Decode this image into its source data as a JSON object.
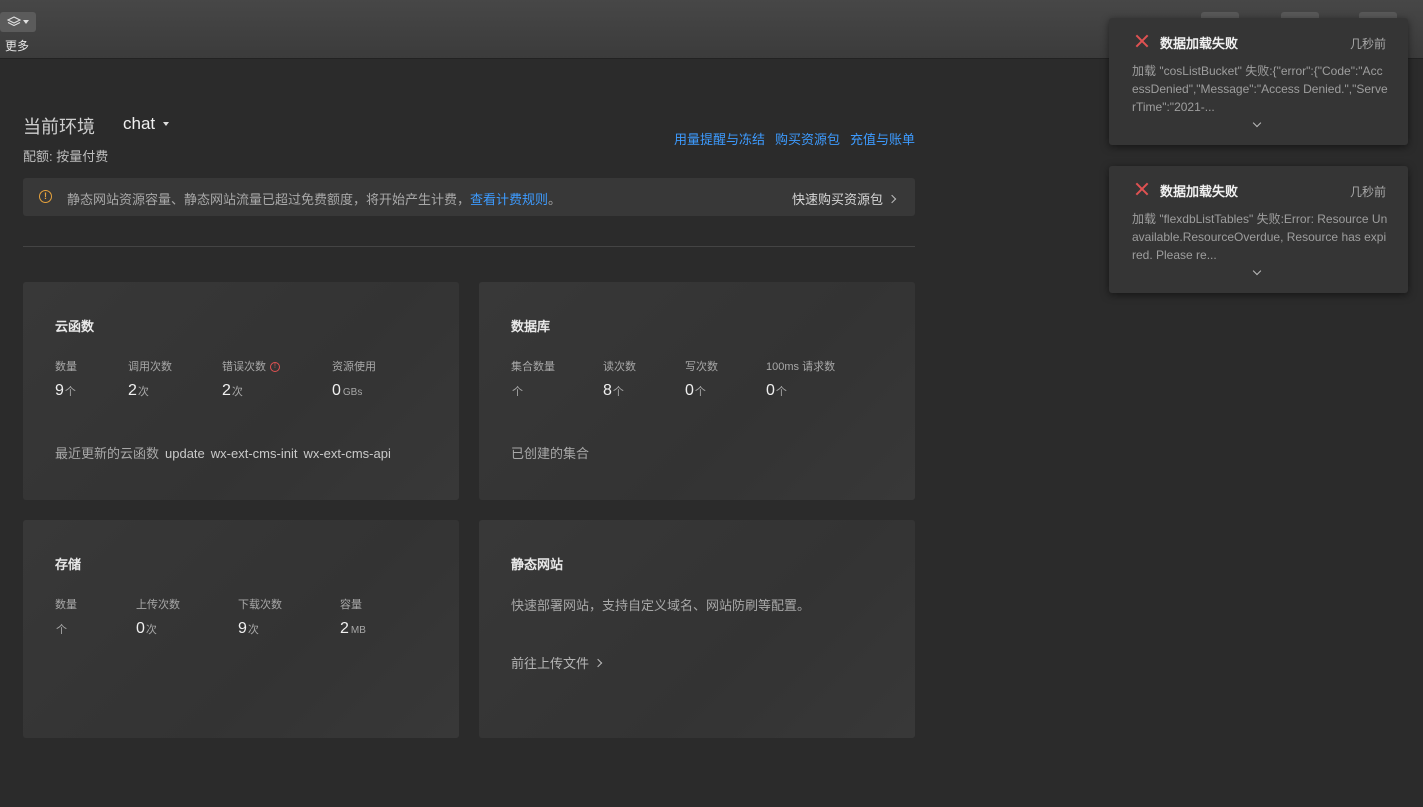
{
  "topbar": {
    "more_label": "更多"
  },
  "env": {
    "label": "当前环境",
    "selected": "chat",
    "quota": "配额: 按量付费"
  },
  "links": {
    "usage_alert": "用量提醒与冻结",
    "buy_package": "购买资源包",
    "recharge": "充值与账单"
  },
  "notice": {
    "message": "静态网站资源容量、静态网站流量已超过免费额度，将开始产生计费，",
    "link": "查看计费规则",
    "suffix": "。",
    "quick_buy": "快速购买资源包",
    "warn_color": "#e6a23c"
  },
  "cards": {
    "functions": {
      "title": "云函数",
      "labels": [
        "数量",
        "调用次数",
        "错误次数",
        "资源使用"
      ],
      "values": [
        "9",
        "2",
        "2",
        "0"
      ],
      "units": [
        "个",
        "次",
        "次",
        "GBs"
      ],
      "footer_label": "最近更新的云函数",
      "recent": [
        "update",
        "wx-ext-cms-init",
        "wx-ext-cms-api"
      ]
    },
    "database": {
      "title": "数据库",
      "labels": [
        "集合数量",
        "读次数",
        "写次数",
        "100ms 请求数"
      ],
      "values": [
        "",
        "8",
        "0",
        "0"
      ],
      "units": [
        "个",
        "个",
        "个",
        "个"
      ],
      "footer_label": "已创建的集合"
    },
    "storage": {
      "title": "存储",
      "labels": [
        "数量",
        "上传次数",
        "下载次数",
        "容量"
      ],
      "values": [
        "",
        "0",
        "9",
        "2"
      ],
      "units": [
        "个",
        "次",
        "次",
        "MB"
      ]
    },
    "website": {
      "title": "静态网站",
      "description": "快速部署网站，支持自定义域名、网站防刷等配置。",
      "upload_link": "前往上传文件"
    }
  },
  "toasts": [
    {
      "title": "数据加载失败",
      "time": "几秒前",
      "body": "加载 \"cosListBucket\" 失败:{\"error\":{\"Code\":\"AccessDenied\",\"Message\":\"Access Denied.\",\"ServerTime\":\"2021-..."
    },
    {
      "title": "数据加载失败",
      "time": "几秒前",
      "body": "加载 \"flexdbListTables\" 失败:Error: Resource Unavailable.ResourceOverdue, Resource has expired. Please re..."
    }
  ],
  "colors": {
    "accent": "#3d9bff",
    "error": "#e05252",
    "background": "#2b2b2b"
  }
}
